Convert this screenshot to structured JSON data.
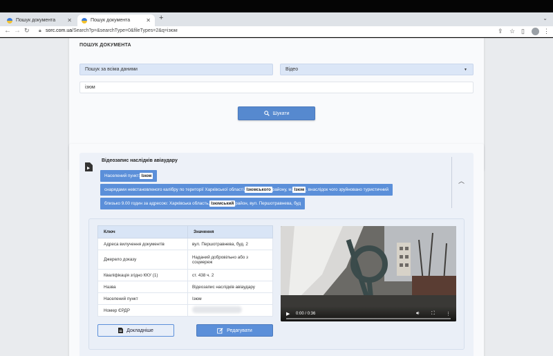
{
  "browser": {
    "tabs": [
      {
        "title": "Пошук документа",
        "active": false
      },
      {
        "title": "Пошук документа",
        "active": true
      }
    ],
    "url_host": "sorc.com.ua",
    "url_path": "/Search?p=&searchType=0&fileTypes=2&q=ізюм"
  },
  "search": {
    "title": "ПОШУК ДОКУМЕНТА",
    "scope_value": "Пошук за всіма даними",
    "type_value": "Відео",
    "query_value": "ізюм",
    "button_label": "Шукати"
  },
  "result": {
    "title": "Відеозапис наслідків авіаудару",
    "chip1": {
      "pre": "Населений пункт: ",
      "hl": "Ізюм"
    },
    "chip2": {
      "pre": "снарядами невстановленого калібру по території Харківської області, ",
      "hl1": "Ізюмського",
      "mid": " району, м. ",
      "hl2": "Ізюм",
      "post": ", внаслідок чого зруйновано туристичний"
    },
    "chip3": {
      "pre": "близько 9.00 годин за адресою: Харківська область, ",
      "hl": "Ізюмський",
      "post": " район, вул. Першотравнева, буд"
    },
    "table": {
      "col_key": "Ключ",
      "col_value": "Значення",
      "rows": [
        {
          "key": "Адреса вилучення документів",
          "value": "вул. Першотравнева, буд. 2"
        },
        {
          "key": "Джерело доказу",
          "value": "Наданий добровільно або з соцмереж"
        },
        {
          "key": "Кваліфікація згідно ККУ (1)",
          "value": "ст. 438 ч. 2"
        },
        {
          "key": "Назва",
          "value": "Відеозапис наслідків авіаудару"
        },
        {
          "key": "Населений пункт",
          "value": "Ізюм"
        },
        {
          "key": "Номер ЄРДР",
          "value": ""
        }
      ]
    },
    "btn_details": "Докладніше",
    "btn_edit": "Редагувати",
    "video_time": "0:00 / 0:36"
  },
  "colors": {
    "accent": "#5b8fd9",
    "field": "#dbe6f7",
    "page": "#e9ebee"
  }
}
